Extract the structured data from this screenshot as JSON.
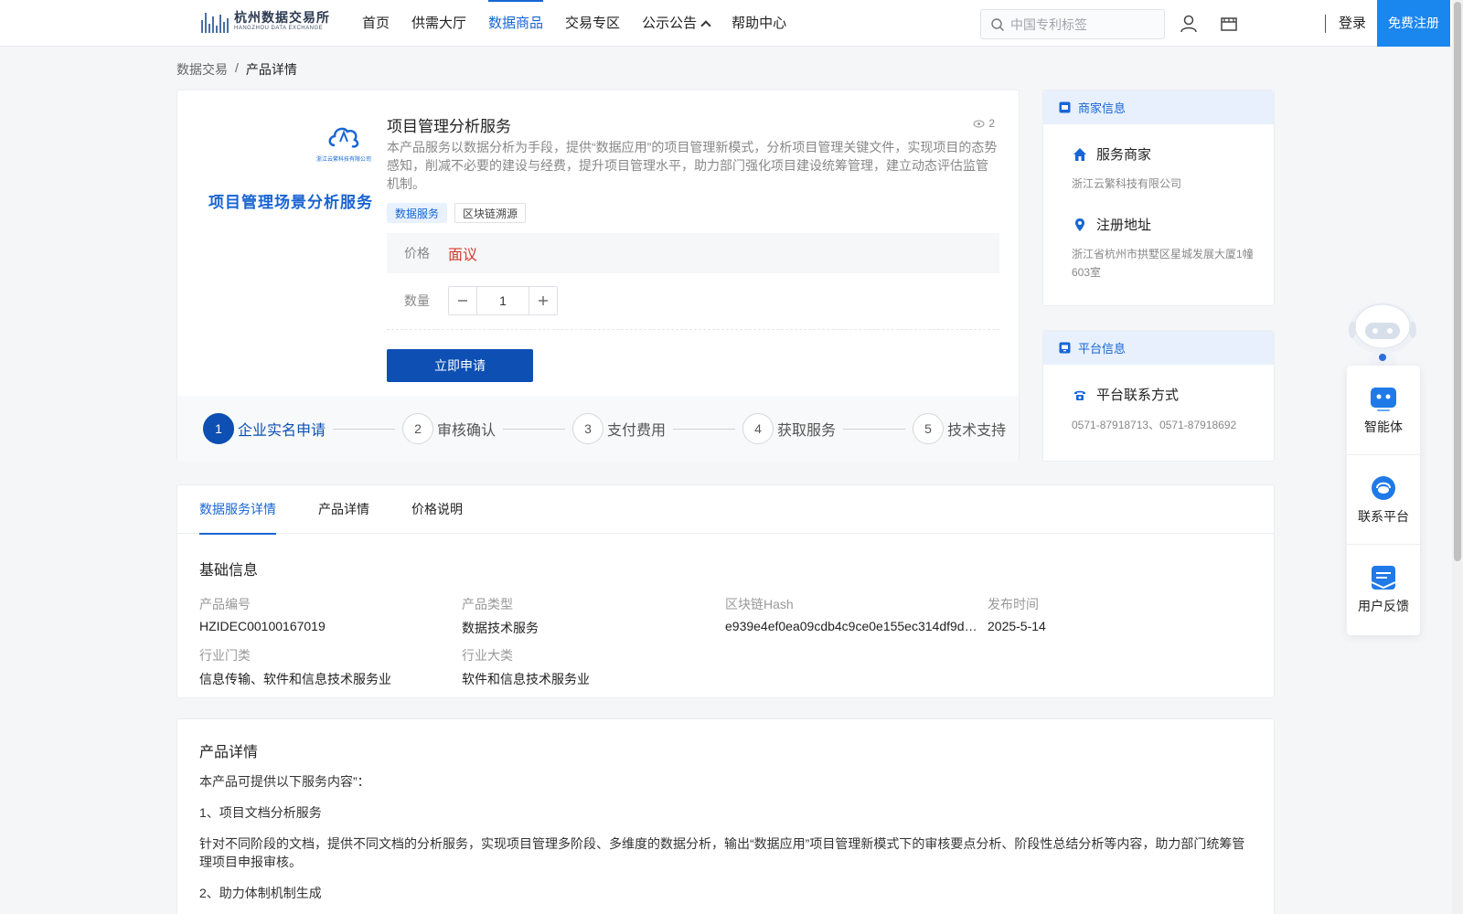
{
  "header": {
    "logo_cn": "杭州数据交易所",
    "logo_en": "HANGZHOU DATA EXCHANGE",
    "nav": [
      {
        "label": "首页"
      },
      {
        "label": "供需大厅"
      },
      {
        "label": "数据商品"
      },
      {
        "label": "交易专区"
      },
      {
        "label": "公示公告"
      },
      {
        "label": "帮助中心"
      }
    ],
    "active_nav": "数据商品",
    "search_placeholder": "中国专利标签",
    "login": "登录",
    "register": "免费注册"
  },
  "breadcrumb": {
    "parent": "数据交易",
    "separator": "/",
    "current": "产品详情"
  },
  "product": {
    "image_title": "项目管理场景分析服务",
    "title": "项目管理分析服务",
    "views": "2",
    "description": "本产品服务以数据分析为手段，提供“数据应用”的项目管理新模式，分析项目管理关键文件，实现项目的态势感知，削减不必要的建设与经费，提升项目管理水平，助力部门强化项目建设统筹管理，建立动态评估监管机制。",
    "tags": [
      "数据服务",
      "区块链溯源"
    ],
    "price_label": "价格",
    "price_value": "面议",
    "qty_label": "数量",
    "qty_value": "1",
    "apply_button": "立即申请",
    "steps": [
      {
        "num": "1",
        "label": "企业实名申请"
      },
      {
        "num": "2",
        "label": "审核确认"
      },
      {
        "num": "3",
        "label": "支付费用"
      },
      {
        "num": "4",
        "label": "获取服务"
      },
      {
        "num": "5",
        "label": "技术支持"
      }
    ]
  },
  "merchant": {
    "heading": "商家信息",
    "service_title": "服务商家",
    "service_value": "浙江云繁科技有限公司",
    "address_title": "注册地址",
    "address_value": "浙江省杭州市拱墅区星城发展大厦1幢603室"
  },
  "platform": {
    "heading": "平台信息",
    "contact_title": "平台联系方式",
    "contact_value": "0571-87918713、0571-87918692"
  },
  "float_panel": {
    "items": [
      {
        "label": "智能体"
      },
      {
        "label": "联系平台"
      },
      {
        "label": "用户反馈"
      }
    ]
  },
  "tabs": [
    "数据服务详情",
    "产品详情",
    "价格说明"
  ],
  "basic_info": {
    "heading": "基础信息",
    "fields": [
      {
        "label": "产品编号",
        "value": "HZIDEC00100167019"
      },
      {
        "label": "产品类型",
        "value": "数据技术服务"
      },
      {
        "label": "区块链Hash",
        "value": "e939e4ef0ea09cdb4c9ce0e155ec314df9d…"
      },
      {
        "label": "发布时间",
        "value": "2025-5-14"
      },
      {
        "label": "行业门类",
        "value": "信息传输、软件和信息技术服务业"
      },
      {
        "label": "行业大类",
        "value": "软件和信息技术服务业"
      }
    ]
  },
  "details": {
    "heading": "产品详情",
    "lines": [
      "本产品可提供以下服务内容”：",
      "1、项目文档分析服务",
      "针对不同阶段的文档，提供不同文档的分析服务，实现项目管理多阶段、多维度的数据分析，输出“数据应用”项目管理新模式下的审核要点分析、阶段性总结分析等内容，助力部门统筹管理项目申报审核。",
      "2、助力体制机制生成"
    ]
  },
  "colors": {
    "primary": "#1766d6",
    "button": "#0d4fb3",
    "price": "#d33a2c",
    "register": "#1a87ef"
  }
}
